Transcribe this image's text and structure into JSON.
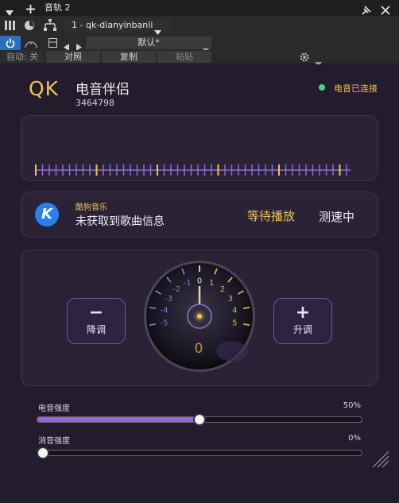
{
  "window": {
    "title": "音轨 2"
  },
  "toolbar": {
    "track_name": "1 - qk-dianyinbanli",
    "preset": "默认*",
    "auto_label": "自动: 关",
    "compare": "对照",
    "copy": "复制",
    "paste": "粘贴"
  },
  "header": {
    "logo": "QK",
    "title": "电音伴侣",
    "id": "3464798",
    "status": "电音已连接"
  },
  "song": {
    "source": "酷狗音乐",
    "info": "未获取到歌曲信息",
    "play_state": "等待播放",
    "speed_state": "测速中",
    "badge": "K"
  },
  "knob": {
    "down_label": "降调",
    "up_label": "升调",
    "down_symbol": "−",
    "up_symbol": "+",
    "value": "0",
    "ticks": [
      "-5",
      "-4",
      "-3",
      "-2",
      "-1",
      "0",
      "1",
      "2",
      "3",
      "4",
      "5"
    ]
  },
  "sliders": {
    "strength": {
      "label": "电音强度",
      "value_text": "50%",
      "level": 0.5
    },
    "denoise": {
      "label": "消音强度",
      "value_text": "0%",
      "level": 0.0
    }
  },
  "colors": {
    "accent_gold": "#f0c15a",
    "accent_purple": "#8f6ad8",
    "connected": "#3fd48a",
    "kugou_blue": "#2a7ff0"
  }
}
